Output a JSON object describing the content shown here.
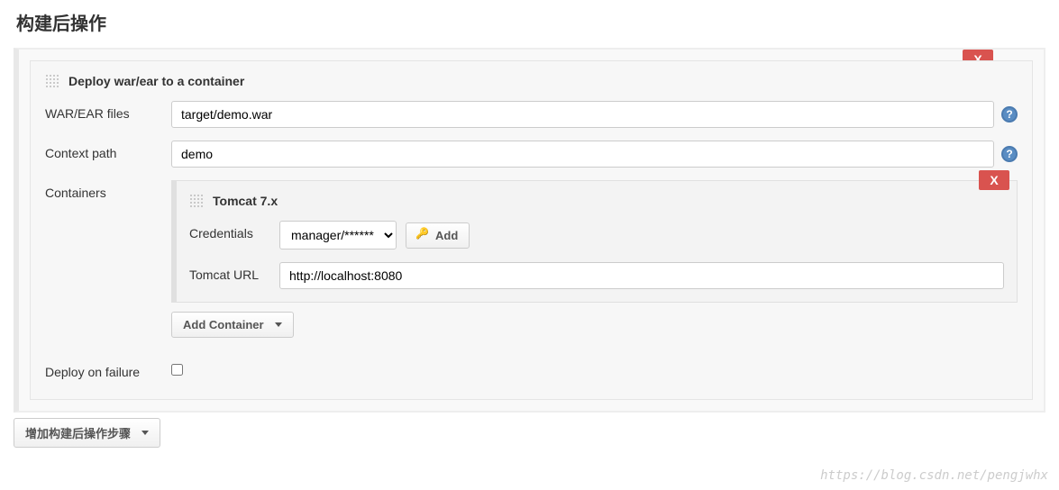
{
  "pageTitle": "构建后操作",
  "section": {
    "title": "Deploy war/ear to a container",
    "closeLabel": "X",
    "fields": {
      "warEar": {
        "label": "WAR/EAR files",
        "value": "target/demo.war"
      },
      "contextPath": {
        "label": "Context path",
        "value": "demo"
      },
      "containers": {
        "label": "Containers",
        "addContainerLabel": "Add Container"
      },
      "deployOnFailure": {
        "label": "Deploy on failure",
        "checked": false
      }
    },
    "container": {
      "title": "Tomcat 7.x",
      "closeLabel": "X",
      "credentials": {
        "label": "Credentials",
        "selected": "manager/******",
        "addLabel": "Add"
      },
      "tomcatUrl": {
        "label": "Tomcat URL",
        "value": "http://localhost:8080"
      }
    }
  },
  "footer": {
    "addPostBuildStep": "增加构建后操作步骤"
  },
  "watermark": "https://blog.csdn.net/pengjwhx"
}
